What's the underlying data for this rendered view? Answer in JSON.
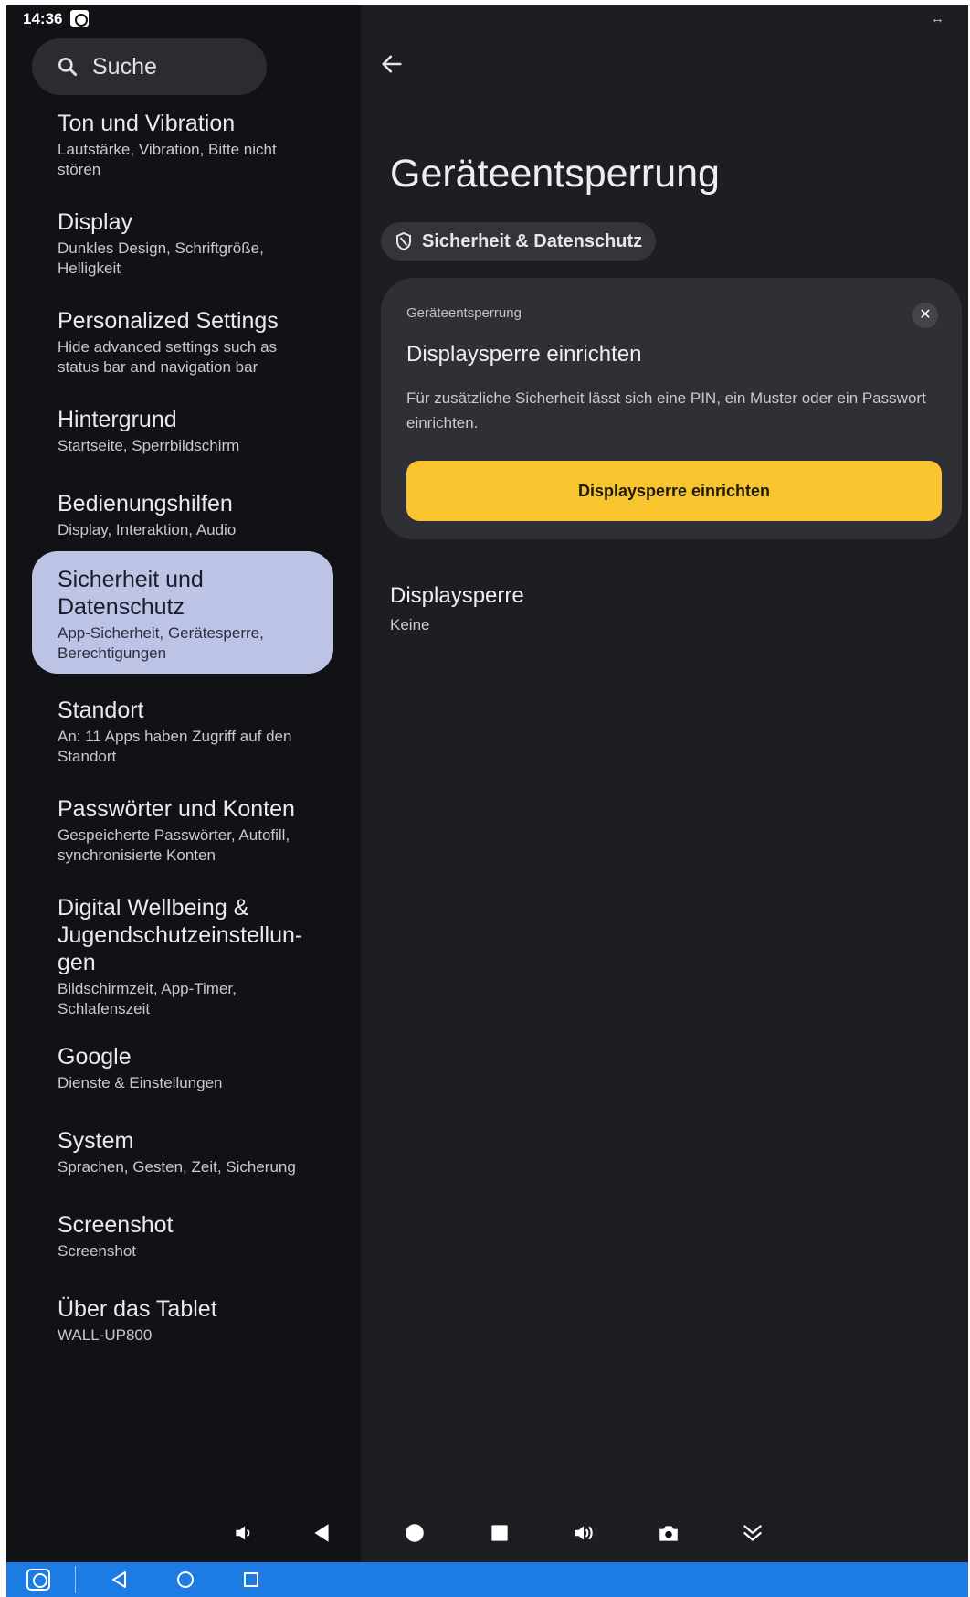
{
  "status_bar": {
    "time": "14:36"
  },
  "search": {
    "label": "Suche"
  },
  "sidebar": {
    "items": [
      {
        "title": "Ton und Vibration",
        "subtitle": "Lautstärke, Vibration, Bitte nicht stören"
      },
      {
        "title": "Display",
        "subtitle": "Dunkles Design, Schriftgröße, Helligkeit"
      },
      {
        "title": "Personalized Settings",
        "subtitle": "Hide advanced settings such as status bar and navigation bar"
      },
      {
        "title": "Hintergrund",
        "subtitle": "Startseite, Sperrbildschirm"
      },
      {
        "title": "Bedienungshilfen",
        "subtitle": "Display, Interaktion, Audio"
      },
      {
        "title": "Sicherheit und Datenschutz",
        "subtitle": "App-Sicherheit, Gerätesperre, Berechtigungen",
        "selected": true
      },
      {
        "title": "Standort",
        "subtitle": "An: 11 Apps haben Zugriff auf den Standort"
      },
      {
        "title": "Passwörter und Konten",
        "subtitle": "Gespeicherte Passwörter, Autofill, synchronisierte Konten"
      },
      {
        "title": "Digital Wellbeing & Jugendschutzeinstellun­gen",
        "subtitle": "Bildschirmzeit, App-Timer, Schlafenszeit"
      },
      {
        "title": "Google",
        "subtitle": "Dienste & Einstellungen"
      },
      {
        "title": "System",
        "subtitle": "Sprachen, Gesten, Zeit, Sicherung"
      },
      {
        "title": "Screenshot",
        "subtitle": "Screenshot"
      },
      {
        "title": "Über das Tablet",
        "subtitle": "WALL-UP800"
      }
    ]
  },
  "detail": {
    "title": "Geräteentsperrung",
    "breadcrumb": "Sicherheit & Datenschutz",
    "card": {
      "overline": "Geräteentsperrung",
      "title": "Displaysperre einrichten",
      "body": "Für zusätzliche Sicherheit lässt sich eine PIN, ein Muster oder ein Passwort einrichten.",
      "action": "Displaysperre einrichten",
      "close_glyph": "✕"
    },
    "preference": {
      "title": "Displaysperre",
      "value": "Keine"
    }
  },
  "colors": {
    "selected_bg": "#bcc3e4",
    "action_bg": "#f8c52f",
    "taskbar": "#1d7be4"
  },
  "icons": [
    "search-icon",
    "back-arrow-icon",
    "shield-icon",
    "close-icon",
    "volume-down-icon",
    "back-triangle-icon",
    "home-circle-icon",
    "recents-square-icon",
    "volume-up-icon",
    "camera-icon",
    "collapse-chevrons-icon"
  ]
}
